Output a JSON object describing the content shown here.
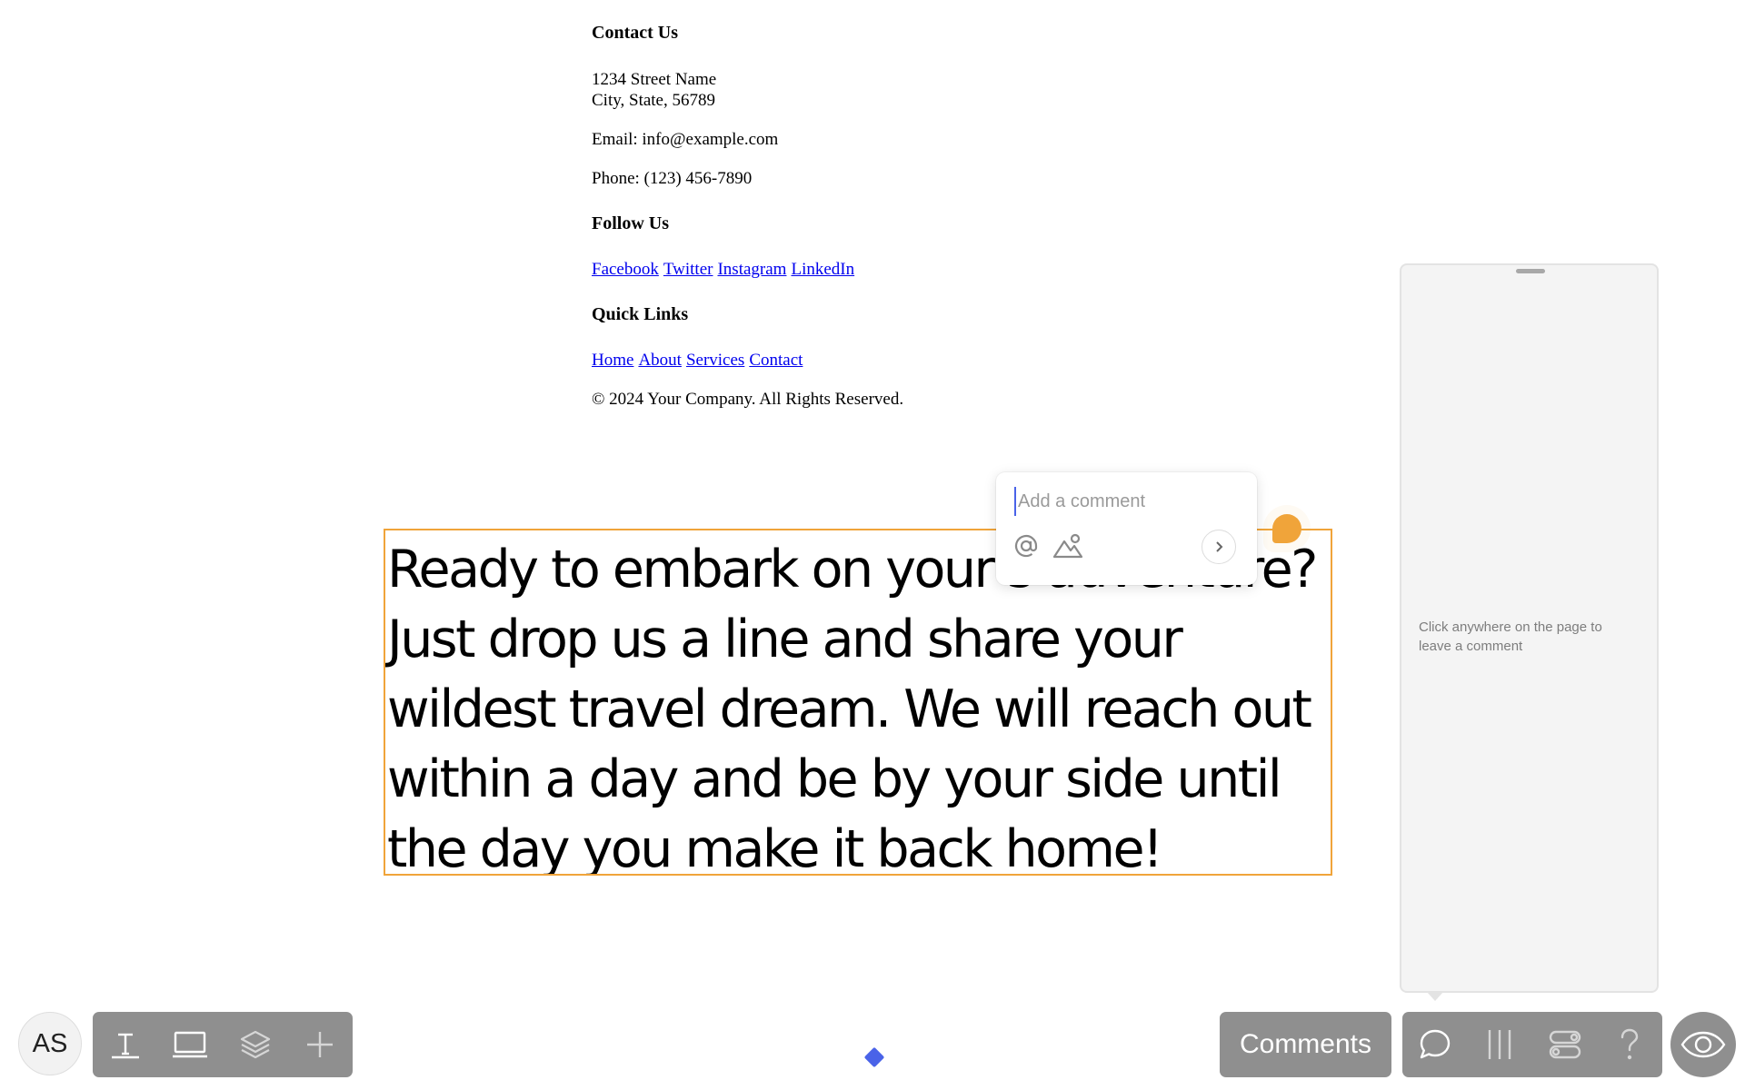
{
  "footer": {
    "contact_heading": "Contact Us",
    "address_line1": "1234 Street Name",
    "address_line2": "City, State, 56789",
    "email": "Email: info@example.com",
    "phone": "Phone: (123) 456-7890",
    "follow_heading": "Follow Us",
    "social_links": [
      "Facebook",
      "Twitter",
      "Instagram",
      "LinkedIn"
    ],
    "quick_links_heading": "Quick Links",
    "quick_links": [
      "Home",
      "About",
      "Services",
      "Contact"
    ],
    "copyright": "© 2024 Your Company. All Rights Reserved."
  },
  "hero": {
    "text": "Ready to embark on your s adventure? Just drop us a line and share your wildest travel dream. We will reach out within a day and be by your side until the day you make it back home!"
  },
  "comment_popup": {
    "placeholder": "Add a comment",
    "value": ""
  },
  "side_panel": {
    "hint": "Click anywhere on the page to leave a comment"
  },
  "bottom_bar": {
    "avatar_initials": "AS",
    "left_tools": [
      "text-tool-icon",
      "frame-tool-icon",
      "layers-icon",
      "add-icon"
    ],
    "comments_label": "Comments",
    "right_tools": [
      "comment-bubble-icon",
      "columns-icon",
      "toggle-settings-icon",
      "help-icon"
    ],
    "preview": "eye-icon"
  },
  "colors": {
    "selection": "#f0a43a",
    "accent": "#4a63e8",
    "toolbar": "#8f8f8f",
    "link": "#0000ee"
  }
}
